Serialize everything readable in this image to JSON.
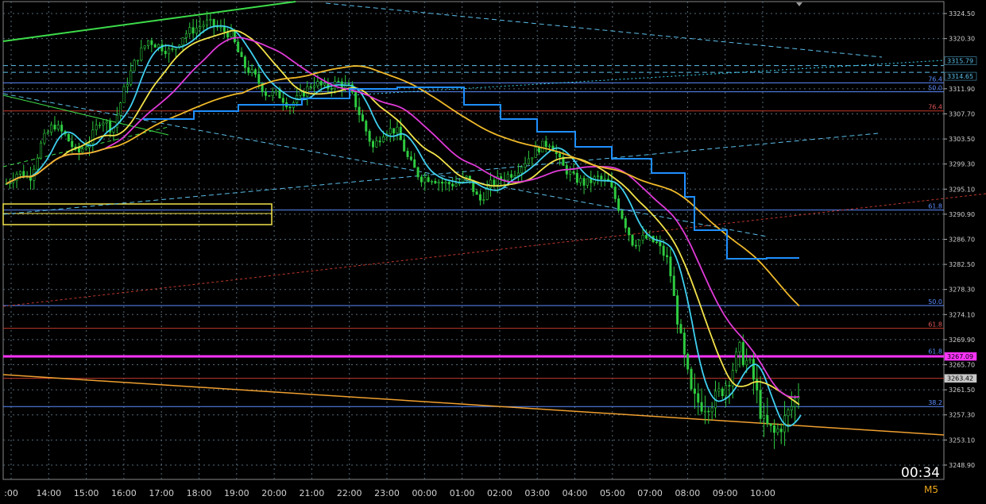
{
  "chart_data": {
    "type": "candlestick",
    "timeframe": "M5",
    "timer": "00:34",
    "symbol_price_current": "3263.42",
    "ylim": [
      3246.5,
      3326.5
    ],
    "y_ticks": [
      "3324.50",
      "3320.30",
      "3311.90",
      "3307.70",
      "3303.50",
      "3299.30",
      "3295.10",
      "3290.90",
      "3286.70",
      "3282.50",
      "3278.30",
      "3274.10",
      "3269.90",
      "3265.70",
      "3261.50",
      "3257.30",
      "3253.10",
      "3248.90"
    ],
    "x_ticks": [
      ":00",
      "14:00",
      "15:00",
      "16:00",
      "17:00",
      "18:00",
      "19:00",
      "20:00",
      "21:00",
      "22:00",
      "23:00",
      "00:00",
      "01:00",
      "02:00",
      "03:00",
      "04:00",
      "05:00",
      "07:00",
      "08:00",
      "09:00",
      "10:00"
    ],
    "price_tags": [
      {
        "text": "3315.79",
        "color": "#5bc0eb"
      },
      {
        "text": "3314.65",
        "color": "#5bc0eb"
      },
      {
        "text": "3267.09",
        "color": "#ff33ff"
      },
      {
        "text": "3263.42",
        "color": "#cccccc"
      }
    ],
    "fib_labels": [
      {
        "text": "76.4",
        "price": 3312.9,
        "color": "#5b8cff"
      },
      {
        "text": "50.0",
        "price": 3311.4,
        "color": "#5b8cff"
      },
      {
        "text": "76.4",
        "price": 3308.2,
        "color": "#e05555"
      },
      {
        "text": "61.8",
        "price": 3291.6,
        "color": "#5b8cff"
      },
      {
        "text": "50.0",
        "price": 3275.6,
        "color": "#5b8cff"
      },
      {
        "text": "61.8",
        "price": 3271.8,
        "color": "#e05555"
      },
      {
        "text": "61.8",
        "price": 3267.3,
        "color": "#5b8cff"
      },
      {
        "text": "38.2",
        "price": 3258.7,
        "color": "#5b8cff"
      }
    ],
    "close_series": [
      3296,
      3298,
      3297,
      3303,
      3306,
      3304,
      3301,
      3303,
      3307,
      3305,
      3312,
      3317,
      3320,
      3319,
      3318,
      3321,
      3322,
      3323,
      3322,
      3321,
      3316,
      3314,
      3311,
      3311,
      3309,
      3311,
      3313,
      3312,
      3313,
      3312,
      3307,
      3302,
      3305,
      3305,
      3300,
      3297,
      3297,
      3296,
      3296,
      3297,
      3293,
      3296,
      3297,
      3298,
      3300,
      3302,
      3303,
      3299,
      3297,
      3296,
      3297,
      3296,
      3291,
      3286,
      3287,
      3286,
      3283,
      3270,
      3260,
      3259,
      3260,
      3263,
      3268,
      3265,
      3256,
      3254,
      3257,
      3261
    ],
    "horizontal_levels": [
      {
        "price": 3315.79,
        "color": "#5bc0eb",
        "dash": "6,4"
      },
      {
        "price": 3314.65,
        "color": "#5bc0eb",
        "dash": "6,4"
      },
      {
        "price": 3312.9,
        "color": "#5b8cff",
        "dash": ""
      },
      {
        "price": 3311.4,
        "color": "#5b8cff",
        "dash": ""
      },
      {
        "price": 3308.2,
        "color": "#c0392b",
        "dash": ""
      },
      {
        "price": 3291.6,
        "color": "#5b8cff",
        "dash": ""
      },
      {
        "price": 3275.6,
        "color": "#5b8cff",
        "dash": ""
      },
      {
        "price": 3271.8,
        "color": "#c0392b",
        "dash": ""
      },
      {
        "price": 3263.42,
        "color": "#c0392b",
        "dash": ""
      },
      {
        "price": 3258.7,
        "color": "#5b8cff",
        "dash": ""
      },
      {
        "price": 3267.09,
        "color": "#ff33ff",
        "dash": ""
      }
    ],
    "colors": {
      "candles": "#2ecc40",
      "ma_cyan": "#3fd0f0",
      "ma_yellow": "#f3e34a",
      "ma_magenta": "#e03ad8",
      "ma_orange": "#f0b92a",
      "step_line": "#1f8fff",
      "grid": "#556b7a",
      "axis_text": "#d0d0d0"
    }
  }
}
